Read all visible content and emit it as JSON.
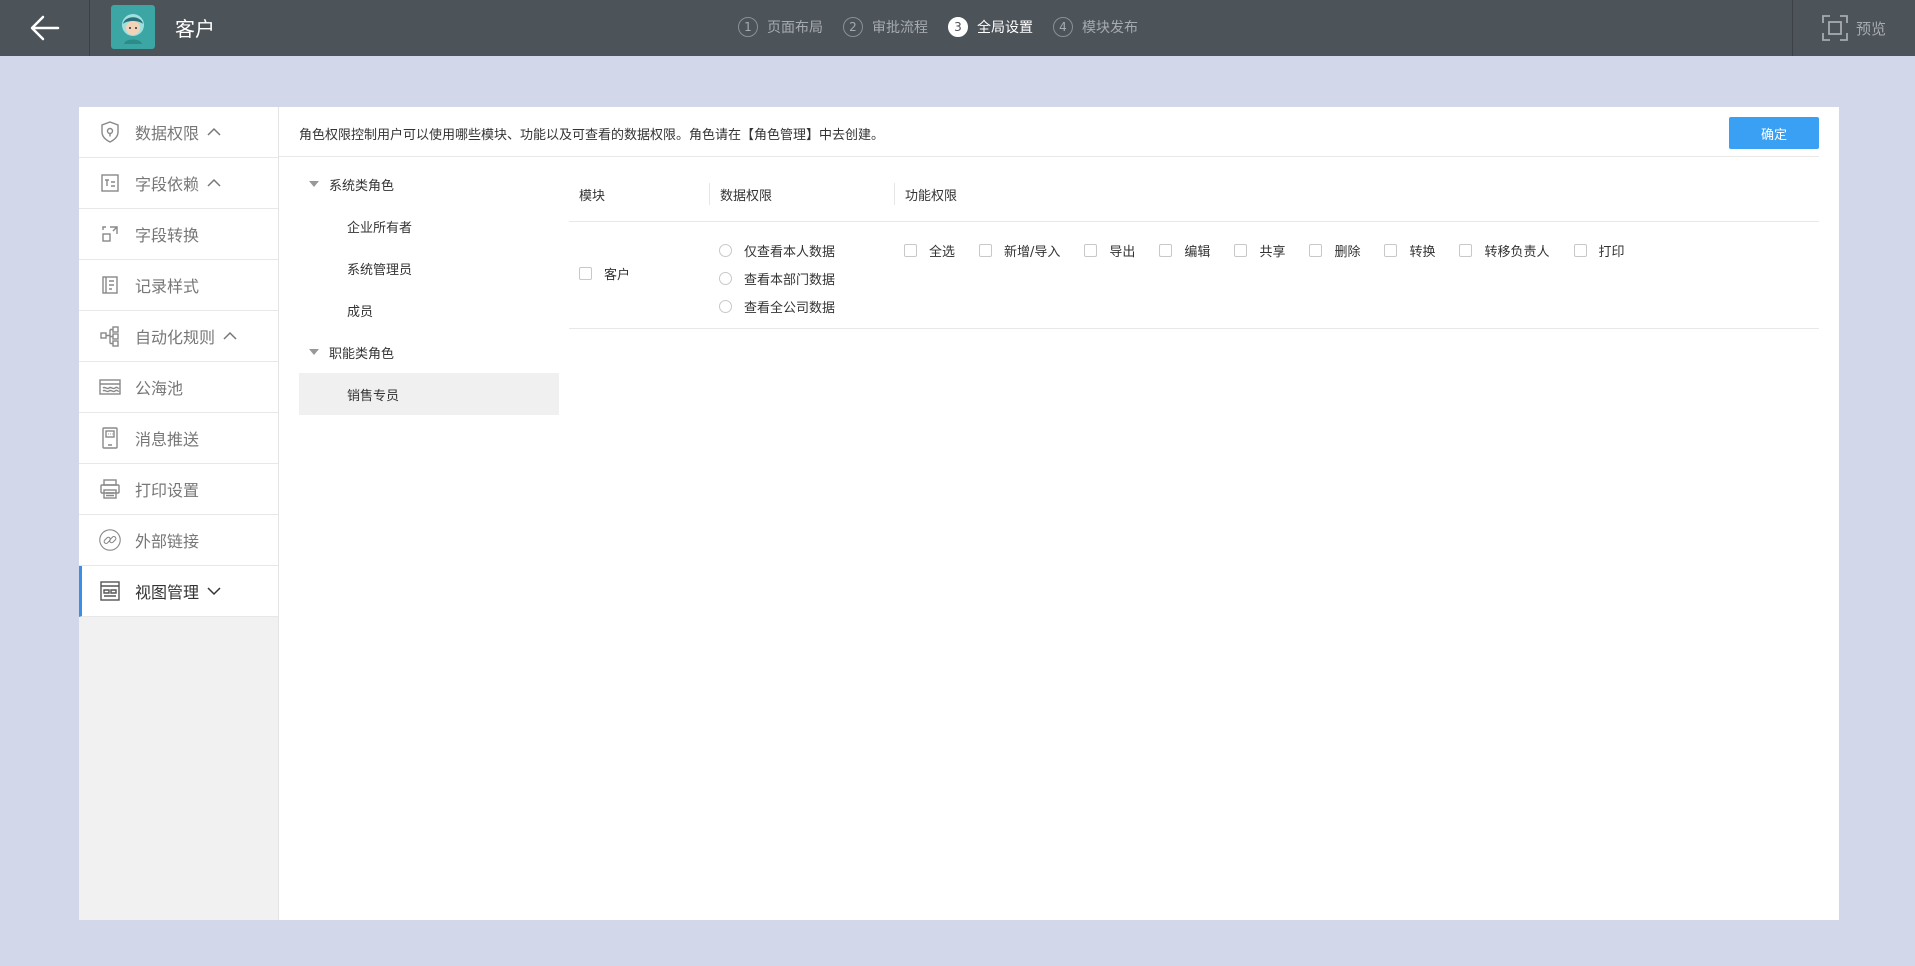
{
  "header": {
    "app_title": "客户",
    "steps": [
      {
        "num": "1",
        "label": "页面布局"
      },
      {
        "num": "2",
        "label": "审批流程"
      },
      {
        "num": "3",
        "label": "全局设置"
      },
      {
        "num": "4",
        "label": "模块发布"
      }
    ],
    "active_step": 3,
    "preview_label": "预览"
  },
  "sidebar": {
    "items": [
      {
        "label": "数据权限",
        "icon": "shield-icon",
        "chevron": "up"
      },
      {
        "label": "字段依赖",
        "icon": "field-dependency-icon",
        "chevron": "up"
      },
      {
        "label": "字段转换",
        "icon": "field-convert-icon"
      },
      {
        "label": "记录样式",
        "icon": "record-style-icon"
      },
      {
        "label": "自动化规则",
        "icon": "automation-icon",
        "chevron": "up"
      },
      {
        "label": "公海池",
        "icon": "pool-icon"
      },
      {
        "label": "消息推送",
        "icon": "message-icon"
      },
      {
        "label": "打印设置",
        "icon": "printer-icon"
      },
      {
        "label": "外部链接",
        "icon": "link-icon"
      },
      {
        "label": "视图管理",
        "icon": "view-icon",
        "chevron": "down",
        "active": true
      }
    ]
  },
  "content": {
    "description": "角色权限控制用户可以使用哪些模块、功能以及可查看的数据权限。角色请在【角色管理】中去创建。",
    "confirm_label": "确定",
    "role_groups": [
      {
        "label": "系统类角色",
        "roles": [
          "企业所有者",
          "系统管理员",
          "成员"
        ]
      },
      {
        "label": "职能类角色",
        "roles": [
          "销售专员"
        ]
      }
    ],
    "selected_role": "销售专员",
    "table": {
      "headers": [
        "模块",
        "数据权限",
        "功能权限"
      ],
      "rows": [
        {
          "module": "客户",
          "data_options": [
            "仅查看本人数据",
            "查看本部门数据",
            "查看全公司数据"
          ],
          "func_options": [
            "全选",
            "新增/导入",
            "导出",
            "编辑",
            "共享",
            "删除",
            "转换",
            "转移负责人",
            "打印"
          ]
        }
      ]
    }
  },
  "colors": {
    "topbar": "#4c5359",
    "background": "#d3d7ea",
    "primary": "#3aa0f3",
    "active_indicator": "#3a8ee6"
  }
}
